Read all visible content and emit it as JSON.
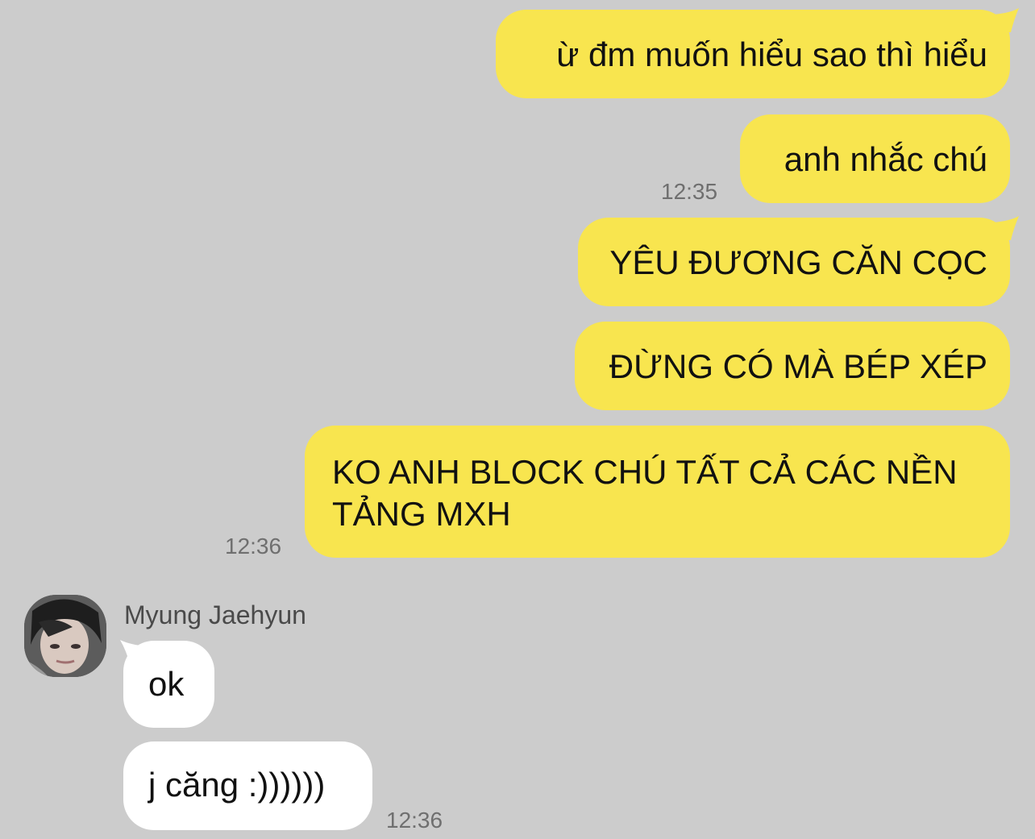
{
  "chat": {
    "outgoing": [
      {
        "text": "ừ đm muốn hiểu sao thì hiểu"
      },
      {
        "text": "anh nhắc chú",
        "time": "12:35"
      },
      {
        "text": "YÊU ĐƯƠNG CĂN CỌC"
      },
      {
        "text": "ĐỪNG CÓ MÀ BÉP XÉP"
      },
      {
        "text_line1": "KO ANH BLOCK CHÚ TẤT CẢ CÁC NỀN",
        "text_line2": "TẢNG MXH",
        "time": "12:36"
      }
    ],
    "incoming": {
      "sender": "Myung Jaehyun",
      "messages": [
        {
          "text": "ok"
        },
        {
          "text": "j căng :))))))",
          "time": "12:36"
        }
      ]
    }
  },
  "colors": {
    "background": "#cccccc",
    "outgoing_bubble": "#f8e54f",
    "incoming_bubble": "#ffffff",
    "timestamp": "#6f6f6f"
  }
}
